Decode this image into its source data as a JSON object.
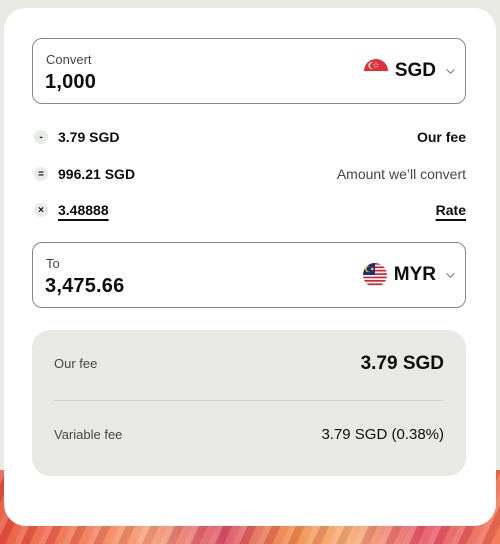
{
  "convert": {
    "label": "Convert",
    "value": "1,000",
    "currency": "SGD",
    "flag_icon": "singapore-flag-icon"
  },
  "breakdown": [
    {
      "op": "-",
      "amount": "3.79 SGD",
      "label": "Our fee"
    },
    {
      "op": "=",
      "amount": "996.21 SGD",
      "label": "Amount we’ll convert"
    },
    {
      "op": "×",
      "amount": "3.48888",
      "label": "Rate"
    }
  ],
  "to": {
    "label": "To",
    "value": "3,475.66",
    "currency": "MYR",
    "flag_icon": "malaysia-flag-icon"
  },
  "fees": {
    "our_fee_label": "Our fee",
    "our_fee_value": "3.79 SGD",
    "variable_fee_label": "Variable fee",
    "variable_fee_value": "3.79 SGD (0.38%)"
  },
  "colors": {
    "background": "#e9e9e4",
    "card": "#ffffff",
    "fee_box": "#e8e9e4",
    "text": "#0e0f0c",
    "muted": "#454745"
  }
}
